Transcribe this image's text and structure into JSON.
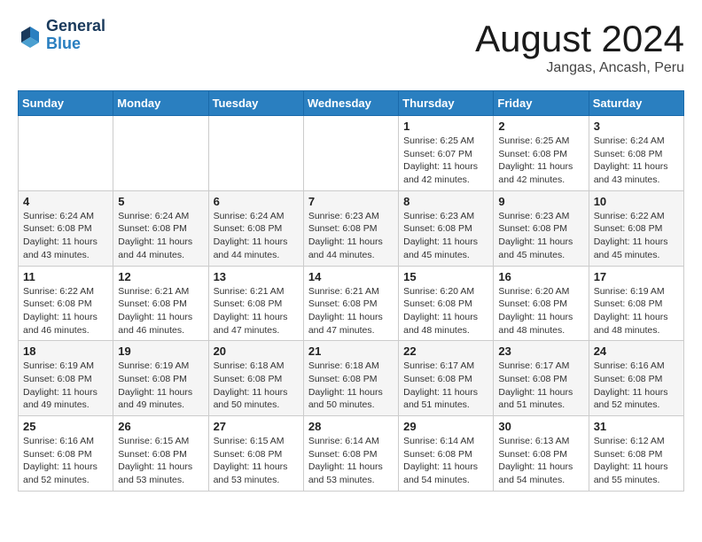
{
  "header": {
    "logo_line1": "General",
    "logo_line2": "Blue",
    "title": "August 2024",
    "subtitle": "Jangas, Ancash, Peru"
  },
  "weekdays": [
    "Sunday",
    "Monday",
    "Tuesday",
    "Wednesday",
    "Thursday",
    "Friday",
    "Saturday"
  ],
  "weeks": [
    [
      {
        "day": "",
        "info": ""
      },
      {
        "day": "",
        "info": ""
      },
      {
        "day": "",
        "info": ""
      },
      {
        "day": "",
        "info": ""
      },
      {
        "day": "1",
        "info": "Sunrise: 6:25 AM\nSunset: 6:07 PM\nDaylight: 11 hours\nand 42 minutes."
      },
      {
        "day": "2",
        "info": "Sunrise: 6:25 AM\nSunset: 6:08 PM\nDaylight: 11 hours\nand 42 minutes."
      },
      {
        "day": "3",
        "info": "Sunrise: 6:24 AM\nSunset: 6:08 PM\nDaylight: 11 hours\nand 43 minutes."
      }
    ],
    [
      {
        "day": "4",
        "info": "Sunrise: 6:24 AM\nSunset: 6:08 PM\nDaylight: 11 hours\nand 43 minutes."
      },
      {
        "day": "5",
        "info": "Sunrise: 6:24 AM\nSunset: 6:08 PM\nDaylight: 11 hours\nand 44 minutes."
      },
      {
        "day": "6",
        "info": "Sunrise: 6:24 AM\nSunset: 6:08 PM\nDaylight: 11 hours\nand 44 minutes."
      },
      {
        "day": "7",
        "info": "Sunrise: 6:23 AM\nSunset: 6:08 PM\nDaylight: 11 hours\nand 44 minutes."
      },
      {
        "day": "8",
        "info": "Sunrise: 6:23 AM\nSunset: 6:08 PM\nDaylight: 11 hours\nand 45 minutes."
      },
      {
        "day": "9",
        "info": "Sunrise: 6:23 AM\nSunset: 6:08 PM\nDaylight: 11 hours\nand 45 minutes."
      },
      {
        "day": "10",
        "info": "Sunrise: 6:22 AM\nSunset: 6:08 PM\nDaylight: 11 hours\nand 45 minutes."
      }
    ],
    [
      {
        "day": "11",
        "info": "Sunrise: 6:22 AM\nSunset: 6:08 PM\nDaylight: 11 hours\nand 46 minutes."
      },
      {
        "day": "12",
        "info": "Sunrise: 6:21 AM\nSunset: 6:08 PM\nDaylight: 11 hours\nand 46 minutes."
      },
      {
        "day": "13",
        "info": "Sunrise: 6:21 AM\nSunset: 6:08 PM\nDaylight: 11 hours\nand 47 minutes."
      },
      {
        "day": "14",
        "info": "Sunrise: 6:21 AM\nSunset: 6:08 PM\nDaylight: 11 hours\nand 47 minutes."
      },
      {
        "day": "15",
        "info": "Sunrise: 6:20 AM\nSunset: 6:08 PM\nDaylight: 11 hours\nand 48 minutes."
      },
      {
        "day": "16",
        "info": "Sunrise: 6:20 AM\nSunset: 6:08 PM\nDaylight: 11 hours\nand 48 minutes."
      },
      {
        "day": "17",
        "info": "Sunrise: 6:19 AM\nSunset: 6:08 PM\nDaylight: 11 hours\nand 48 minutes."
      }
    ],
    [
      {
        "day": "18",
        "info": "Sunrise: 6:19 AM\nSunset: 6:08 PM\nDaylight: 11 hours\nand 49 minutes."
      },
      {
        "day": "19",
        "info": "Sunrise: 6:19 AM\nSunset: 6:08 PM\nDaylight: 11 hours\nand 49 minutes."
      },
      {
        "day": "20",
        "info": "Sunrise: 6:18 AM\nSunset: 6:08 PM\nDaylight: 11 hours\nand 50 minutes."
      },
      {
        "day": "21",
        "info": "Sunrise: 6:18 AM\nSunset: 6:08 PM\nDaylight: 11 hours\nand 50 minutes."
      },
      {
        "day": "22",
        "info": "Sunrise: 6:17 AM\nSunset: 6:08 PM\nDaylight: 11 hours\nand 51 minutes."
      },
      {
        "day": "23",
        "info": "Sunrise: 6:17 AM\nSunset: 6:08 PM\nDaylight: 11 hours\nand 51 minutes."
      },
      {
        "day": "24",
        "info": "Sunrise: 6:16 AM\nSunset: 6:08 PM\nDaylight: 11 hours\nand 52 minutes."
      }
    ],
    [
      {
        "day": "25",
        "info": "Sunrise: 6:16 AM\nSunset: 6:08 PM\nDaylight: 11 hours\nand 52 minutes."
      },
      {
        "day": "26",
        "info": "Sunrise: 6:15 AM\nSunset: 6:08 PM\nDaylight: 11 hours\nand 53 minutes."
      },
      {
        "day": "27",
        "info": "Sunrise: 6:15 AM\nSunset: 6:08 PM\nDaylight: 11 hours\nand 53 minutes."
      },
      {
        "day": "28",
        "info": "Sunrise: 6:14 AM\nSunset: 6:08 PM\nDaylight: 11 hours\nand 53 minutes."
      },
      {
        "day": "29",
        "info": "Sunrise: 6:14 AM\nSunset: 6:08 PM\nDaylight: 11 hours\nand 54 minutes."
      },
      {
        "day": "30",
        "info": "Sunrise: 6:13 AM\nSunset: 6:08 PM\nDaylight: 11 hours\nand 54 minutes."
      },
      {
        "day": "31",
        "info": "Sunrise: 6:12 AM\nSunset: 6:08 PM\nDaylight: 11 hours\nand 55 minutes."
      }
    ]
  ]
}
